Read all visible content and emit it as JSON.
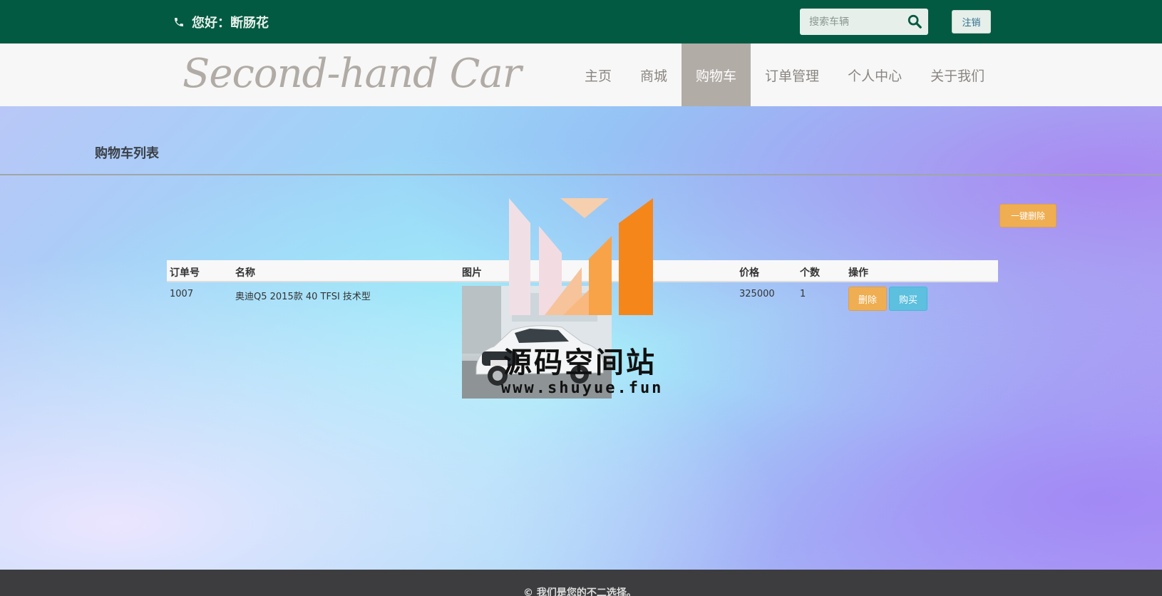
{
  "header": {
    "greeting": "您好：断肠花",
    "search_placeholder": "搜索车辆",
    "logout_label": "注销",
    "accent": "#015a41"
  },
  "navbar": {
    "logo_text": "Second-hand Car",
    "items": [
      {
        "label": "主页"
      },
      {
        "label": "商城"
      },
      {
        "label": "购物车",
        "active": true
      },
      {
        "label": "订单管理"
      },
      {
        "label": "个人中心"
      },
      {
        "label": "关于我们"
      }
    ]
  },
  "cart": {
    "title": "购物车列表",
    "bulk_delete_label": "一键删除",
    "columns": [
      "订单号",
      "名称",
      "图片",
      "价格",
      "个数",
      "操作"
    ],
    "rows": [
      {
        "order_no": "1007",
        "name": "奥迪Q5 2015款 40 TFSI 技术型",
        "image_alt": "car-photo",
        "price": "325000",
        "quantity": "1",
        "delete_label": "删除",
        "buy_label": "购买"
      }
    ]
  },
  "watermark": {
    "text_cn": "源码空间站",
    "url": "www.shuyue.fun"
  },
  "footer": {
    "text": "© 我们是您的不二选择。"
  }
}
